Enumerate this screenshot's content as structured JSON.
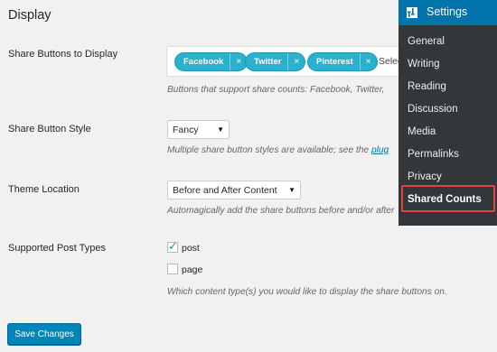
{
  "section": {
    "title": "Display"
  },
  "share_buttons": {
    "label": "Share Buttons to Display",
    "chips": [
      {
        "label": "Facebook",
        "remove": "×"
      },
      {
        "label": "Twitter",
        "remove": "×"
      },
      {
        "label": "Pinterest",
        "remove": "×"
      }
    ],
    "placeholder": "Selec",
    "description": "Buttons that support share counts: Facebook, Twitter,"
  },
  "button_style": {
    "label": "Share Button Style",
    "value": "Fancy",
    "description": "Multiple share button styles are available; see the ",
    "link": "plug"
  },
  "theme_location": {
    "label": "Theme Location",
    "value": "Before and After Content",
    "description": "Automagically add the share buttons before and/or after"
  },
  "post_types": {
    "label": "Supported Post Types",
    "options": [
      {
        "label": "post",
        "checked": true
      },
      {
        "label": "page",
        "checked": false
      }
    ],
    "description": "Which content type(s) you would like to display the share buttons on."
  },
  "save_button": {
    "label": "Save Changes"
  },
  "admin_menu": {
    "header": "Settings",
    "items": [
      "General",
      "Writing",
      "Reading",
      "Discussion",
      "Media",
      "Permalinks",
      "Privacy",
      "Shared Counts"
    ],
    "active": "Shared Counts"
  },
  "colors": {
    "menu_bg": "#32373c",
    "menu_header_bg": "#0073aa",
    "chip_bg": "#2bb1d0",
    "highlight_border": "#e0443c",
    "button_bg": "#0085ba"
  }
}
